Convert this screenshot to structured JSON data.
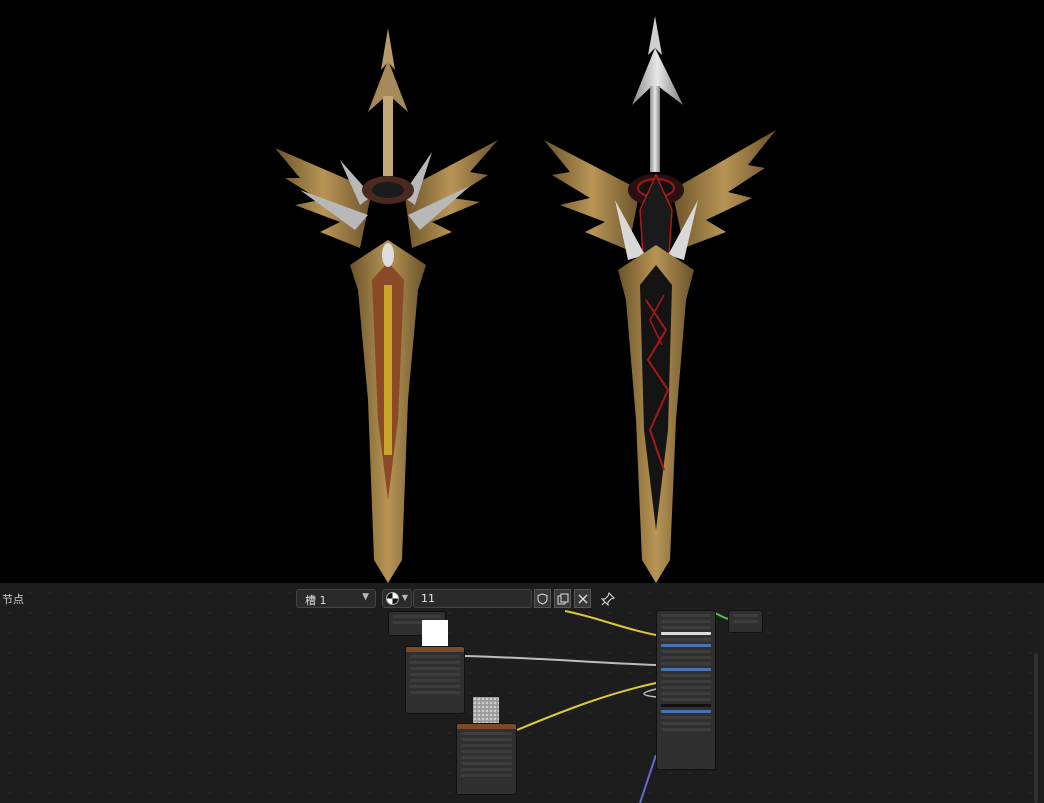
{
  "node_editor": {
    "title": "节点",
    "slot": "槽 1",
    "material_name": "11"
  }
}
